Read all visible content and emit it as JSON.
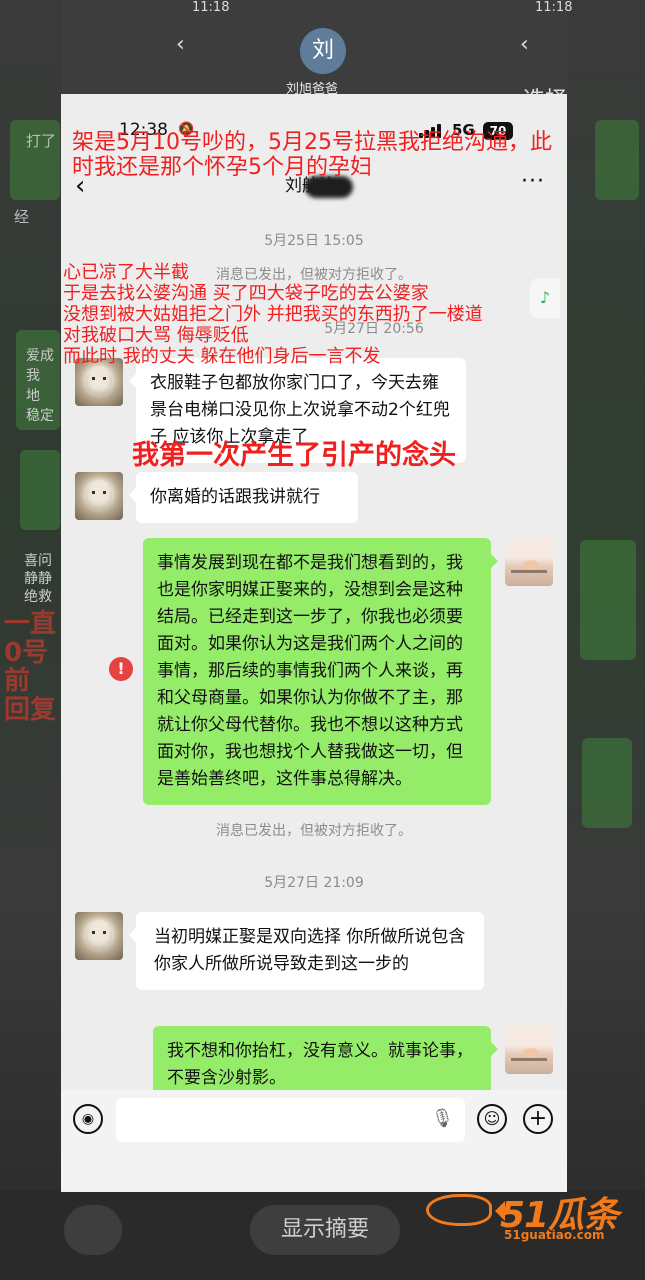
{
  "background": {
    "status_time_left": "11:18",
    "status_time_right": "11:18",
    "contact_name": "刘旭爸爸",
    "avatar_letter": "刘",
    "select_label": "选择",
    "summary_button": "显示摘要",
    "side_fragments": {
      "left_red": "一直\n0号\n前\n回复",
      "left_text_1": "打了",
      "left_text_2": "经",
      "left_text_3": "爱成\n我\n地\n稳定",
      "left_text_4": "喜问\n静静\n绝救"
    }
  },
  "status_bar": {
    "time": "12:38",
    "network": "5G",
    "battery": "70"
  },
  "nav": {
    "back_icon": "‹",
    "title": "刘航汶",
    "more_icon": "···"
  },
  "timestamps": {
    "t1": "5月25日 15:05",
    "t2": "5月27日 20:56",
    "t3": "5月27日 21:09"
  },
  "system_notices": {
    "rejected_1": "消息已发出，但被对方拒收了。",
    "rejected_2": "消息已发出，但被对方拒收了。"
  },
  "messages": [
    {
      "side": "left",
      "text": "衣服鞋子包都放你家门口了，今天去雍景台电梯口没见你上次说拿不动2个红兜子 应该你上次拿走了"
    },
    {
      "side": "left",
      "text": "你离婚的话跟我讲就行"
    },
    {
      "side": "right",
      "text": "事情发展到现在都不是我们想看到的，我也是你家明媒正娶来的，没想到会是这种结局。已经走到这一步了，你我也必须要面对。如果你认为这是我们两个人之间的事情，那后续的事情我们两个人来谈，再和父母商量。如果你认为你做不了主，那就让你父母代替你。我也不想以这种方式面对你，我也想找个人替我做这一切，但是善始善终吧，这件事总得解决。"
    },
    {
      "side": "left",
      "text": "当初明媒正娶是双向选择 你所做所说包含你家人所做所说导致走到这一步的"
    },
    {
      "side": "right",
      "text": "我不想和你抬杠，没有意义。就事论事，不要含沙射影。"
    }
  ],
  "annotations": {
    "top": "架是5月10号吵的，5月25号拉黑我拒绝沟通，此时我还是那个怀孕5个月的孕妇",
    "middle_1": "心已凉了大半截",
    "middle_2": "于是去找公婆沟通 买了四大袋子吃的去公婆家",
    "middle_3": "没想到被大姑姐拒之门外 并把我买的东西扔了一楼道",
    "middle_4": "对我破口大骂 侮辱贬低",
    "middle_5": "而此时 我的丈夫 躲在他们身后一言不发",
    "bold": "我第一次产生了引产的念头"
  },
  "error_icon": "!",
  "input_bar": {
    "voice_icon": "◉",
    "mic_icon": "🎙",
    "emoji_icon": "☺",
    "plus_icon": "+"
  },
  "watermark": {
    "main": "51瓜条",
    "sub": "51guatiao.com"
  },
  "icons": {
    "music": "♪"
  },
  "colors": {
    "green_bubble": "#95ec69",
    "annotation_red": "#f02020",
    "error_red": "#e64340",
    "watermark_orange": "#f07a1c"
  }
}
